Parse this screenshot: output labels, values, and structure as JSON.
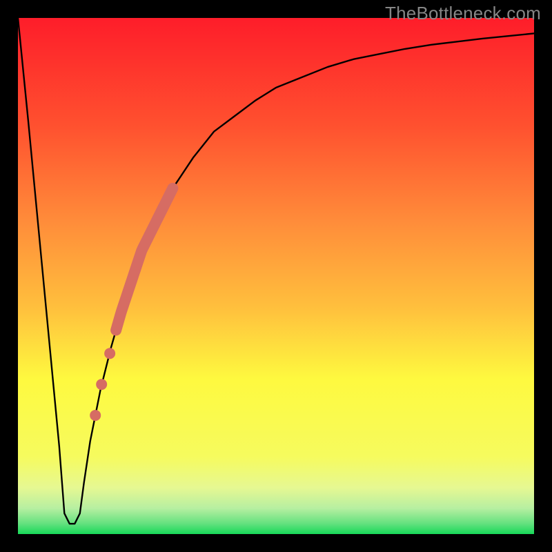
{
  "watermark": "TheBottleneck.com",
  "colors": {
    "frame": "#000000",
    "curve": "#000000",
    "markers": "#d66c63",
    "gradient_top": "#fe1d2a",
    "gradient_mid1": "#ff8e3a",
    "gradient_mid2": "#fef93f",
    "gradient_mid3": "#eef978",
    "gradient_bottom": "#17d858"
  },
  "chart_data": {
    "type": "line",
    "title": "",
    "xlabel": "",
    "ylabel": "",
    "xlim": [
      0,
      100
    ],
    "ylim": [
      0,
      100
    ],
    "gradient_stops": [
      {
        "pos": 0.0,
        "color": "#fe1d2a"
      },
      {
        "pos": 0.4,
        "color": "#ff8e3a"
      },
      {
        "pos": 0.7,
        "color": "#fef93f"
      },
      {
        "pos": 0.88,
        "color": "#eef978"
      },
      {
        "pos": 0.96,
        "color": "#8de98c"
      },
      {
        "pos": 1.0,
        "color": "#17d858"
      }
    ],
    "series": [
      {
        "name": "bottleneck-curve",
        "x": [
          0,
          2,
          4,
          6,
          8,
          9,
          10,
          11,
          12,
          12.8,
          14,
          16,
          18,
          20,
          22,
          24,
          26,
          28,
          30,
          34,
          38,
          42,
          46,
          50,
          55,
          60,
          65,
          70,
          75,
          80,
          85,
          90,
          95,
          100
        ],
        "y": [
          100,
          80,
          59,
          38,
          17,
          4,
          2,
          2,
          4,
          10,
          18,
          28,
          36,
          43,
          49,
          55,
          59,
          63,
          67,
          73,
          78,
          81,
          84,
          86.5,
          88.5,
          90.5,
          92,
          93,
          94,
          94.8,
          95.4,
          96,
          96.5,
          97
        ]
      }
    ],
    "highlight_band": {
      "name": "thick-marker-band",
      "x_range": [
        19,
        30
      ],
      "y_range": [
        41,
        67
      ]
    },
    "highlight_dots": [
      {
        "x": 17.8,
        "y": 35
      },
      {
        "x": 16.2,
        "y": 29
      },
      {
        "x": 15.0,
        "y": 23
      }
    ],
    "min_point": {
      "x": 10.5,
      "y": 2
    }
  }
}
